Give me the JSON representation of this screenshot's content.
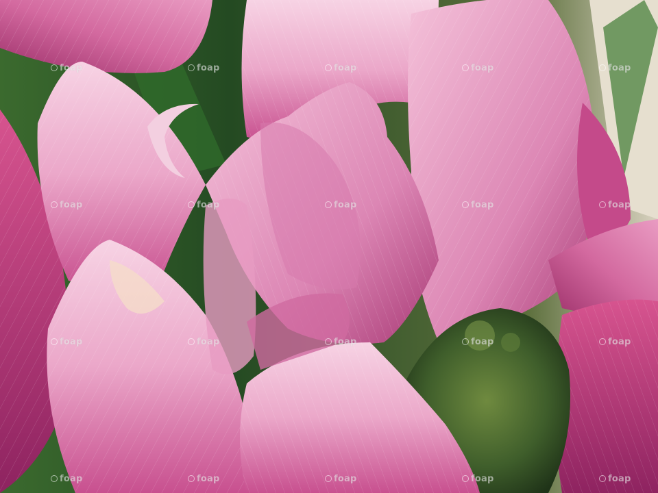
{
  "photo": {
    "subject": "pink-flower-petals",
    "palette": {
      "petal_light": "#f2b6d2",
      "petal_mid": "#e27fb0",
      "petal_deep": "#b83a7e",
      "petal_shadow": "#8e2c63",
      "foliage": "#2f5a2a",
      "center": "#3f5e2b",
      "background_light": "#d9d2c0"
    }
  },
  "watermark": {
    "text": "foap",
    "icon": "foap-logo-icon",
    "repeat_cols": 5,
    "repeat_rows": 4
  }
}
